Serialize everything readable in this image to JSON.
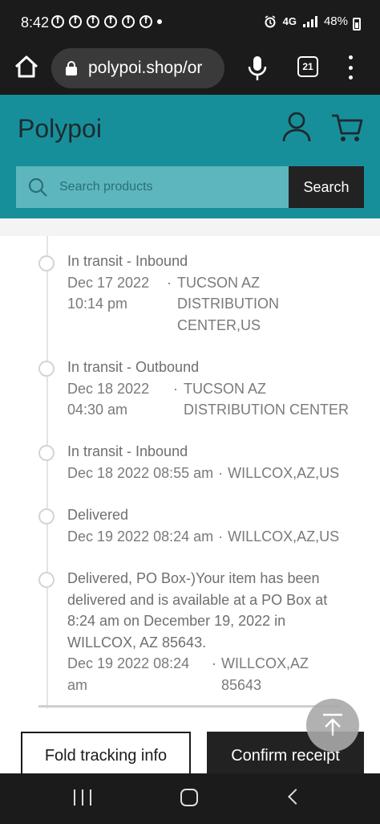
{
  "status_bar": {
    "time": "8:42",
    "network": "4G",
    "battery": "48%"
  },
  "browser": {
    "url": "polypoi.shop/or",
    "tab_count": "21"
  },
  "site": {
    "logo": "Polypoi",
    "search_placeholder": "Search products",
    "search_button": "Search",
    "accent_color": "#178f9b"
  },
  "tracking": {
    "events": [
      {
        "status": "In transit - Inbound",
        "date_line1": "Dec 17 2022",
        "date_line2": "10:14 pm",
        "loc_line1": "TUCSON AZ",
        "loc_line2": "DISTRIBUTION",
        "loc_line3": "CENTER,US"
      },
      {
        "status": "In transit - Outbound",
        "date_line1": "Dec 18 2022",
        "date_line2": "04:30 am",
        "loc_line1": "TUCSON AZ",
        "loc_line2": "DISTRIBUTION CENTER"
      },
      {
        "status": "In transit - Inbound",
        "date": "Dec 18 2022 08:55 am",
        "location": "WILLCOX,AZ,US"
      },
      {
        "status": "Delivered",
        "date": "Dec 19 2022 08:24 am",
        "location": "WILLCOX,AZ,US"
      },
      {
        "description": "Delivered, PO Box-)Your item has been delivered and is available at a PO Box at 8:24 am on December 19, 2022 in WILLCOX, AZ 85643.",
        "date_line1": "Dec 19 2022 08:24",
        "date_line2": "am",
        "loc_line1": "WILLCOX,AZ",
        "loc_line2": "85643"
      }
    ],
    "separator": "·"
  },
  "actions": {
    "fold_label": "Fold tracking info",
    "confirm_label": "Confirm receipt"
  }
}
